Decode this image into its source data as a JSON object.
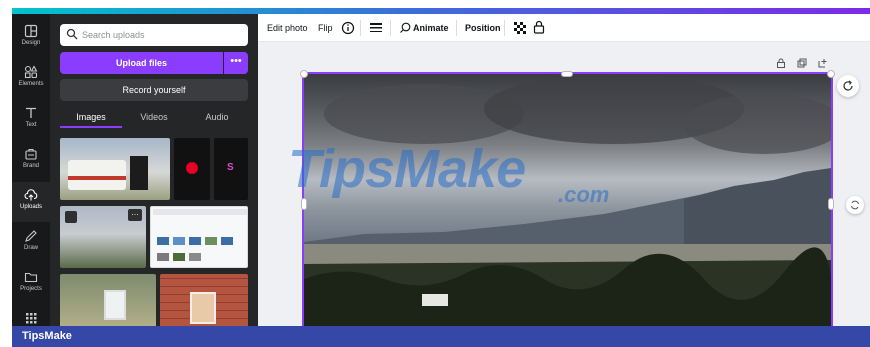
{
  "rail": {
    "items": [
      {
        "label": "Design",
        "icon": "layout-icon"
      },
      {
        "label": "Elements",
        "icon": "shapes-icon"
      },
      {
        "label": "Text",
        "icon": "text-icon"
      },
      {
        "label": "Brand",
        "icon": "brand-icon"
      },
      {
        "label": "Uploads",
        "icon": "cloud-upload-icon"
      },
      {
        "label": "Draw",
        "icon": "pen-icon"
      },
      {
        "label": "Projects",
        "icon": "folder-icon"
      },
      {
        "label": "",
        "icon": "apps-grid-icon"
      }
    ]
  },
  "panel": {
    "search_placeholder": "Search uploads",
    "upload_label": "Upload files",
    "more_label": "•••",
    "record_label": "Record yourself",
    "tabs": [
      "Images",
      "Videos",
      "Audio"
    ],
    "active_tab": "Images"
  },
  "toolbar": {
    "edit_photo": "Edit photo",
    "flip": "Flip",
    "animate": "Animate",
    "position": "Position"
  },
  "watermark": {
    "main": "TipsMake",
    "sub": ".com"
  },
  "footer": {
    "brand": "TipsMake"
  },
  "colors": {
    "accent": "#8b3dff",
    "rail_bg": "#18191b",
    "panel_bg": "#252627",
    "footer_bg": "#3548a8"
  }
}
